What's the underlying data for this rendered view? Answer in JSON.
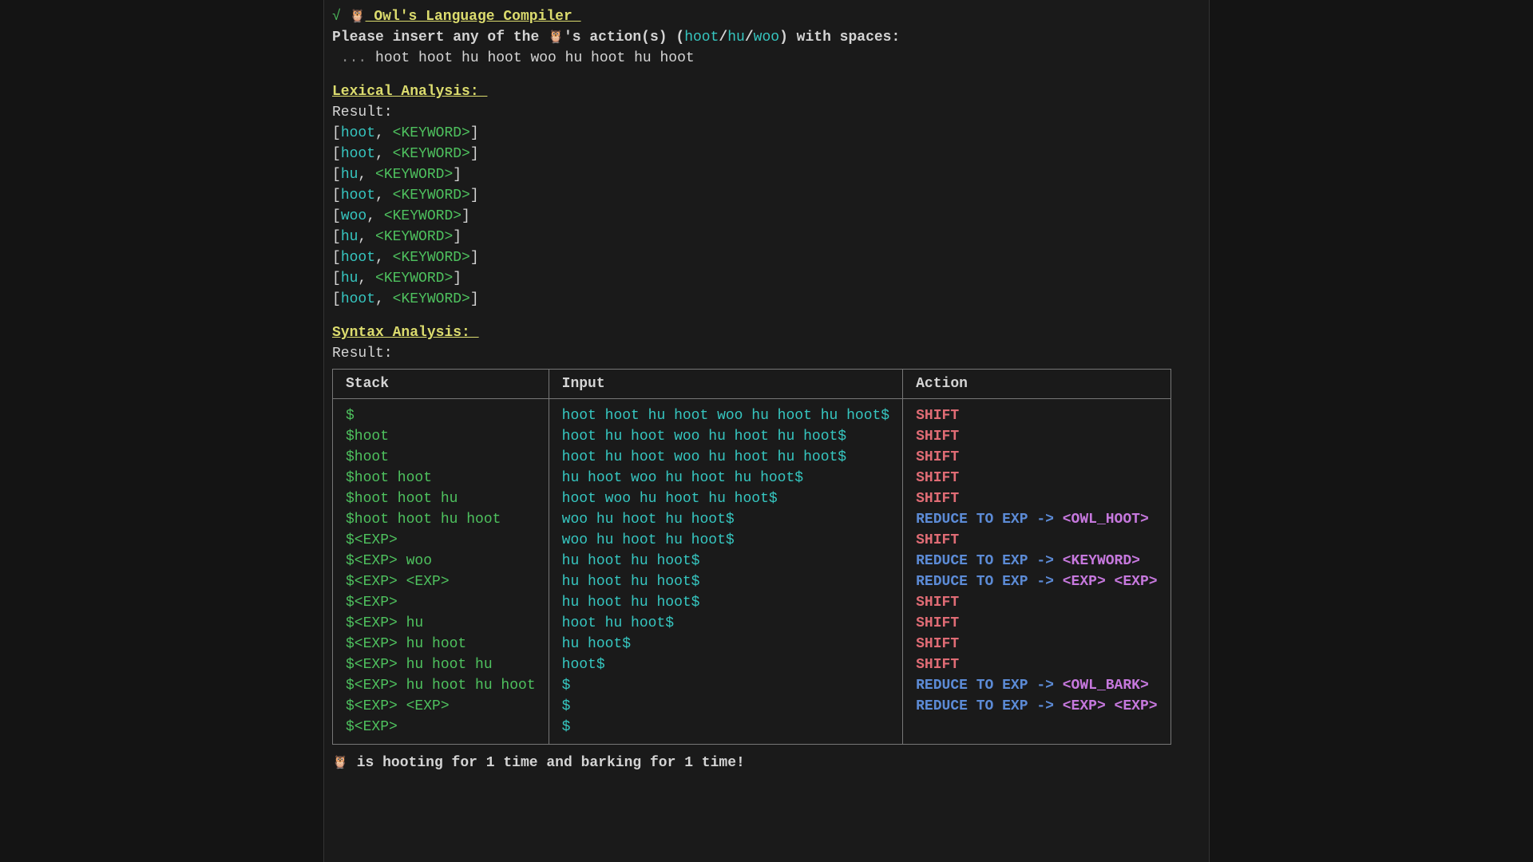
{
  "header": {
    "check": "√",
    "owl_icon": "🦉",
    "title": " Owl's Language Compiler ",
    "prompt_prefix": "Please insert any of the ",
    "prompt_owl": "🦉",
    "prompt_mid": "'s action(s) (",
    "action1": "hoot",
    "slash": "/",
    "action2": "hu",
    "action3": "woo",
    "prompt_suffix": ") with spaces:",
    "input_prefix": " ... ",
    "input_value": "hoot hoot hu hoot woo hu hoot hu hoot"
  },
  "lexical": {
    "heading": "Lexical Analysis: ",
    "result_label": "Result:",
    "tokens": [
      {
        "word": "hoot",
        "type": "<KEYWORD>"
      },
      {
        "word": "hoot",
        "type": "<KEYWORD>"
      },
      {
        "word": "hu",
        "type": "<KEYWORD>"
      },
      {
        "word": "hoot",
        "type": "<KEYWORD>"
      },
      {
        "word": "woo",
        "type": "<KEYWORD>"
      },
      {
        "word": "hu",
        "type": "<KEYWORD>"
      },
      {
        "word": "hoot",
        "type": "<KEYWORD>"
      },
      {
        "word": "hu",
        "type": "<KEYWORD>"
      },
      {
        "word": "hoot",
        "type": "<KEYWORD>"
      }
    ]
  },
  "syntax": {
    "heading": "Syntax Analysis: ",
    "result_label": "Result:",
    "columns": {
      "stack": "Stack",
      "input": "Input",
      "action": "Action"
    },
    "rows": [
      {
        "stack": "$",
        "input": "hoot hoot hu hoot woo hu hoot hu hoot$",
        "action": {
          "kind": "shift",
          "text": "SHIFT"
        }
      },
      {
        "stack": "$hoot",
        "input": "hoot hu hoot woo hu hoot hu hoot$",
        "action": {
          "kind": "shift",
          "text": "SHIFT"
        }
      },
      {
        "stack": "$hoot",
        "input": "hoot hu hoot woo hu hoot hu hoot$",
        "action": {
          "kind": "shift",
          "text": "SHIFT"
        }
      },
      {
        "stack": "$hoot hoot",
        "input": "hu hoot woo hu hoot hu hoot$",
        "action": {
          "kind": "shift",
          "text": "SHIFT"
        }
      },
      {
        "stack": "$hoot hoot hu",
        "input": "hoot woo hu hoot hu hoot$",
        "action": {
          "kind": "shift",
          "text": "SHIFT"
        }
      },
      {
        "stack": "$hoot hoot hu hoot",
        "input": "woo hu hoot hu hoot$",
        "action": {
          "kind": "reduce",
          "text": "REDUCE TO EXP -> ",
          "to": "<OWL_HOOT>"
        }
      },
      {
        "stack": "$<EXP>",
        "input": "woo hu hoot hu hoot$",
        "action": {
          "kind": "shift",
          "text": "SHIFT"
        }
      },
      {
        "stack": "$<EXP> woo",
        "input": "hu hoot hu hoot$",
        "action": {
          "kind": "reduce",
          "text": "REDUCE TO EXP -> ",
          "to": "<KEYWORD>"
        }
      },
      {
        "stack": "$<EXP> <EXP>",
        "input": "hu hoot hu hoot$",
        "action": {
          "kind": "reduce",
          "text": "REDUCE TO EXP -> ",
          "to": "<EXP> <EXP>"
        }
      },
      {
        "stack": "$<EXP>",
        "input": "hu hoot hu hoot$",
        "action": {
          "kind": "shift",
          "text": "SHIFT"
        }
      },
      {
        "stack": "$<EXP> hu",
        "input": "hoot hu hoot$",
        "action": {
          "kind": "shift",
          "text": "SHIFT"
        }
      },
      {
        "stack": "$<EXP> hu hoot",
        "input": "hu hoot$",
        "action": {
          "kind": "shift",
          "text": "SHIFT"
        }
      },
      {
        "stack": "$<EXP> hu hoot hu",
        "input": "hoot$",
        "action": {
          "kind": "shift",
          "text": "SHIFT"
        }
      },
      {
        "stack": "$<EXP> hu hoot hu hoot",
        "input": "$",
        "action": {
          "kind": "reduce",
          "text": "REDUCE TO EXP -> ",
          "to": "<OWL_BARK>"
        }
      },
      {
        "stack": "$<EXP> <EXP>",
        "input": "$",
        "action": {
          "kind": "reduce",
          "text": "REDUCE TO EXP -> ",
          "to": "<EXP> <EXP>"
        }
      },
      {
        "stack": "$<EXP>",
        "input": "$",
        "action": {
          "kind": "none",
          "text": ""
        }
      }
    ]
  },
  "footer": {
    "owl_icon": "🦉",
    "text": " is hooting for 1 time and barking for 1 time!"
  }
}
